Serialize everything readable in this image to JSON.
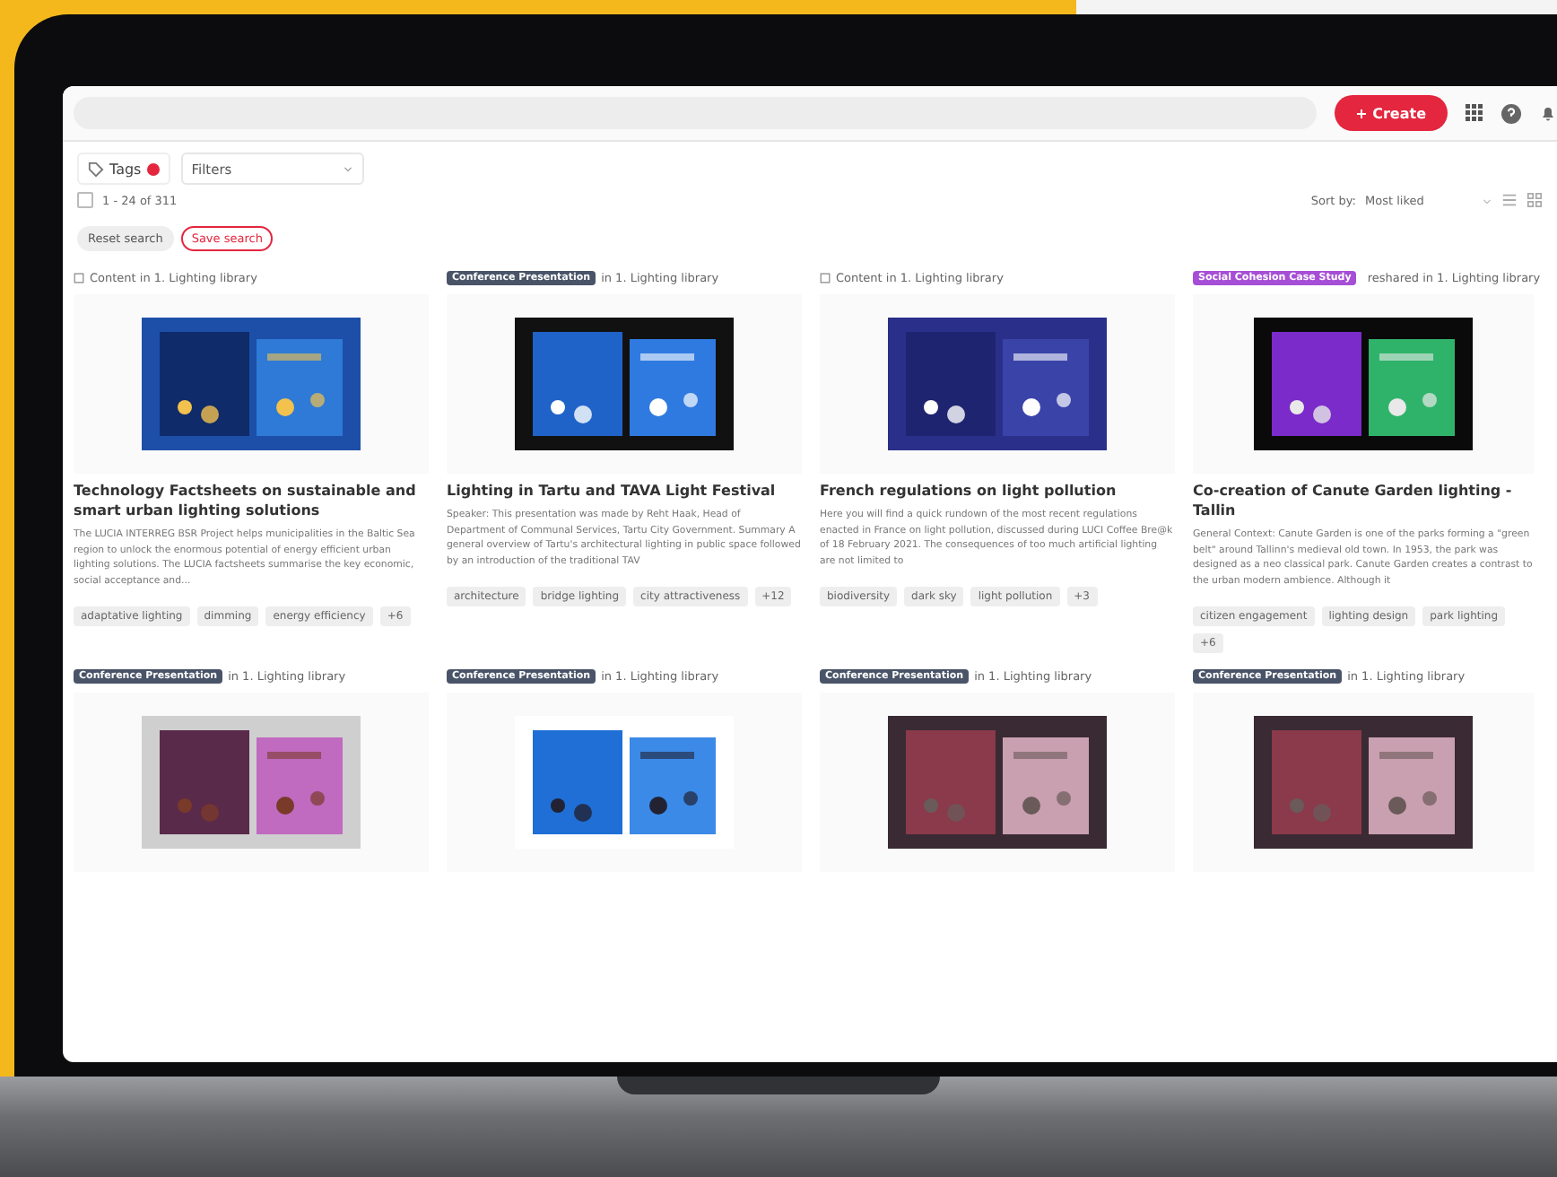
{
  "topbar": {
    "create_button": "+ Create"
  },
  "toolbar": {
    "tags_button": "Tags",
    "filters": {
      "placeholder": "Filters"
    },
    "select_all": {
      "checked": false
    },
    "count": "1 - 24 of 311",
    "reset_button": "Reset search",
    "save_button": "Save search",
    "sort_label": "Sort by:",
    "sort_value": "Most liked"
  },
  "cards": [
    {
      "kind": "content",
      "badge": "Content",
      "source": "in 1. Lighting library",
      "title": "Technology Factsheets on sustainable and smart urban lighting solutions",
      "description": "The LUCIA INTERREG BSR Project helps municipalities in the Baltic Sea region to unlock the enormous potential of energy efficient urban lighting solutions. The LUCIA factsheets summarise the key economic, social acceptance and...",
      "tags": [
        "adaptative lighting",
        "dimming",
        "energy efficiency",
        "+6"
      ]
    },
    {
      "kind": "badge",
      "badge": "Conference Presentation",
      "color": "#4a5468",
      "source": "in 1. Lighting library",
      "title": "Lighting in Tartu and TAVA Light Festival",
      "description": "Speaker: This presentation was made by Reht Haak, Head of Department of Communal Services, Tartu City Government. Summary A general overview of Tartu's architectural lighting in public space followed by an introduction of the traditional TAV",
      "tags": [
        "architecture",
        "bridge lighting",
        "city attractiveness",
        "+12"
      ]
    },
    {
      "kind": "content",
      "badge": "Content",
      "source": "in 1. Lighting library",
      "title": "French regulations on light pollution",
      "description": "Here you will find a quick rundown of the most recent regulations enacted in France on light pollution, discussed during LUCI Coffee Bre@k of 18 February 2021. The consequences of too much artificial lighting are not limited to",
      "tags": [
        "biodiversity",
        "dark sky",
        "light pollution",
        "+3"
      ]
    },
    {
      "kind": "badge",
      "badge": "Social Cohesion Case Study",
      "color": "#a64fd6",
      "source": "reshared in 1. Lighting library",
      "title": "Co-creation of Canute Garden lighting - Tallin",
      "description": "General Context: Canute Garden is one of the parks forming a \"green belt\" around Tallinn's medieval old town. In 1953, the park was designed as a neo classical park. Canute Garden creates a contrast to the urban modern ambience. Although it",
      "tags": [
        "citizen engagement",
        "lighting design",
        "park lighting",
        "+6"
      ]
    },
    {
      "kind": "badge",
      "badge": "Conference Presentation",
      "color": "#4a5468",
      "source": "in 1. Lighting library"
    },
    {
      "kind": "badge",
      "badge": "Conference Presentation",
      "color": "#4a5468",
      "source": "in 1. Lighting library"
    },
    {
      "kind": "badge",
      "badge": "Conference Presentation",
      "color": "#4a5468",
      "source": "in 1. Lighting library"
    },
    {
      "kind": "badge",
      "badge": "Conference Presentation",
      "color": "#4a5468",
      "source": "in 1. Lighting library"
    }
  ]
}
